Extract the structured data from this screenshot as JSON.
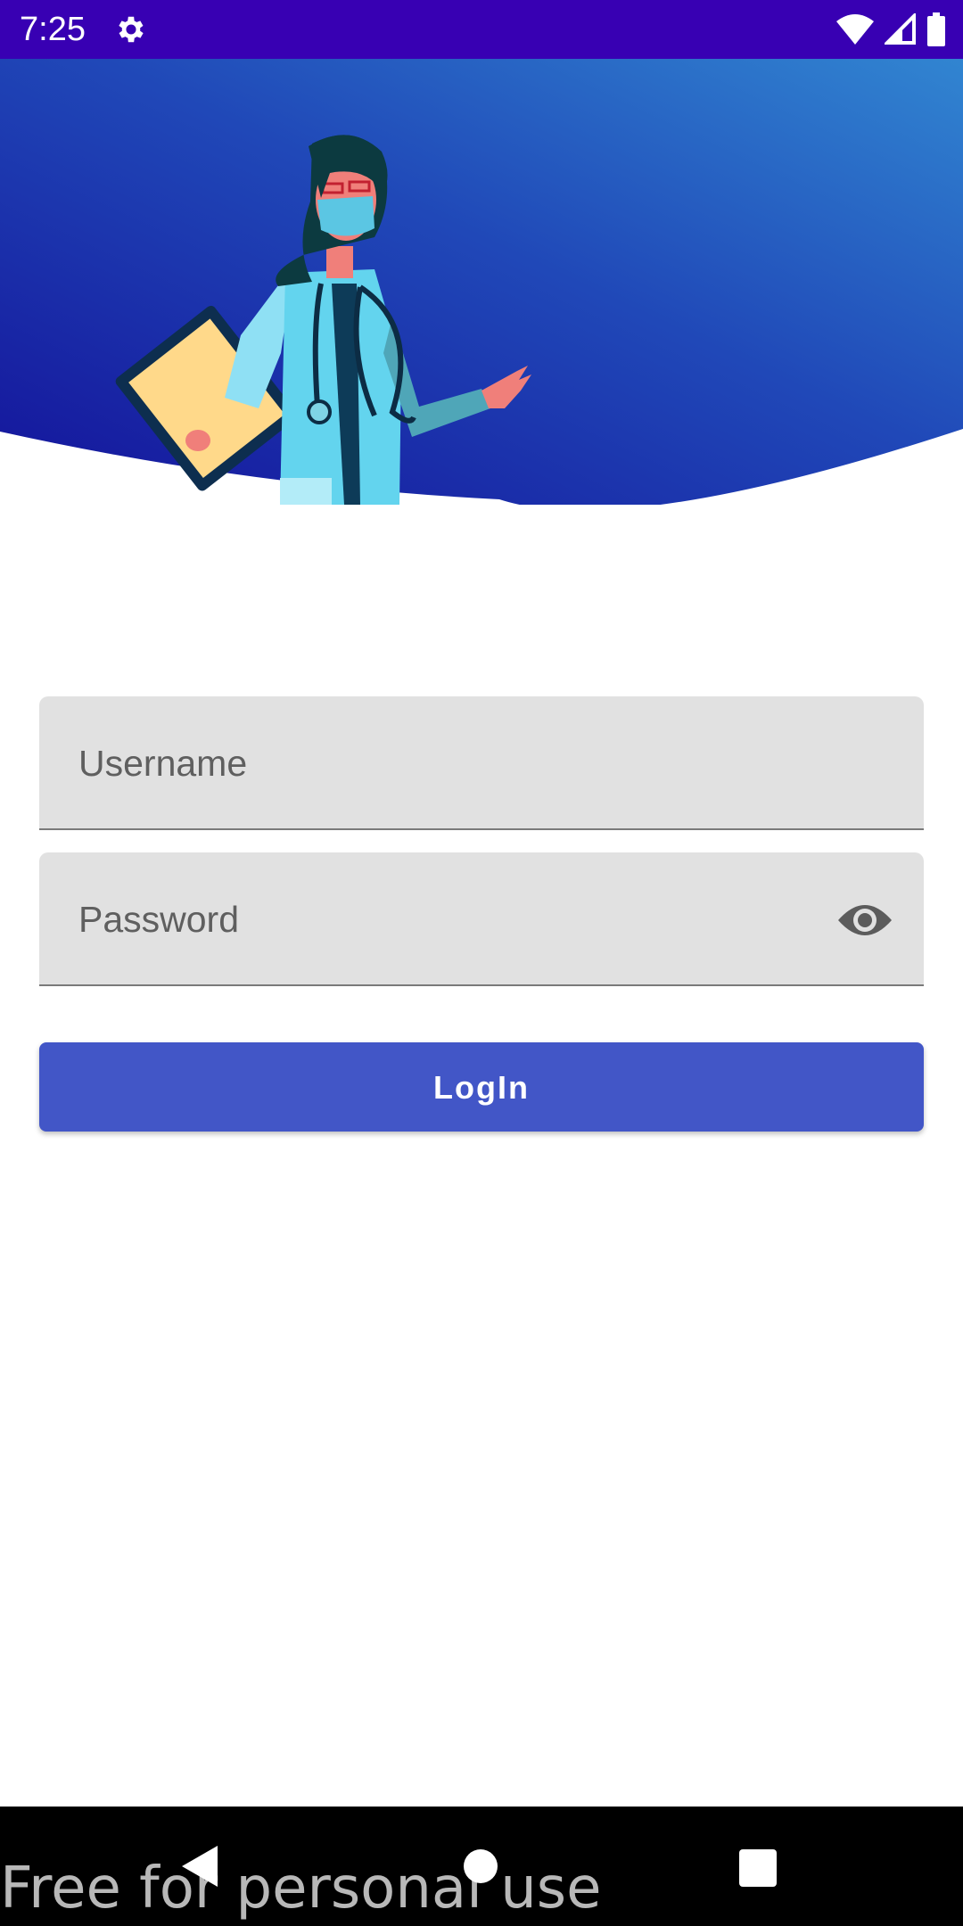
{
  "status_bar": {
    "time": "7:25",
    "icons": [
      "gear-icon",
      "wifi-icon",
      "cell-signal-icon",
      "battery-icon"
    ],
    "background": "#3800b3"
  },
  "header": {
    "illustration": "doctor-illustration",
    "gradient": [
      "#1a1ba3",
      "#2f80cf"
    ]
  },
  "form": {
    "username": {
      "placeholder": "Username",
      "value": ""
    },
    "password": {
      "placeholder": "Password",
      "value": "",
      "toggle_icon": "eye-icon"
    },
    "login_label": "LogIn",
    "accent": "#4256c7"
  },
  "nav_bar": {
    "buttons": [
      "back-icon",
      "home-icon",
      "recents-icon"
    ]
  },
  "watermark": "Free for personal use"
}
